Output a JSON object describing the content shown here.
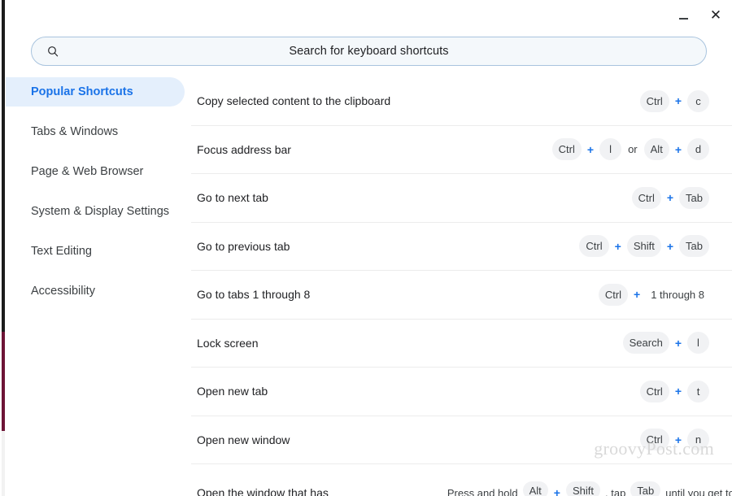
{
  "window": {
    "minimize_label": "Minimize",
    "close_label": "Close"
  },
  "search": {
    "icon": "search-icon",
    "placeholder": "Search for keyboard shortcuts",
    "value": ""
  },
  "sidebar": {
    "items": [
      {
        "label": "Popular Shortcuts",
        "active": true
      },
      {
        "label": "Tabs & Windows",
        "active": false
      },
      {
        "label": "Page & Web Browser",
        "active": false
      },
      {
        "label": "System & Display Settings",
        "active": false
      },
      {
        "label": "Text Editing",
        "active": false
      },
      {
        "label": "Accessibility",
        "active": false
      }
    ]
  },
  "shortcuts": {
    "rows": [
      {
        "label": "Copy selected content to the clipboard",
        "keys": [
          {
            "type": "chip",
            "text": "Ctrl"
          },
          {
            "type": "plus",
            "text": "+"
          },
          {
            "type": "chip",
            "text": "c"
          }
        ]
      },
      {
        "label": "Focus address bar",
        "keys": [
          {
            "type": "chip",
            "text": "Ctrl"
          },
          {
            "type": "plus",
            "text": "+"
          },
          {
            "type": "chip",
            "text": "l"
          },
          {
            "type": "or",
            "text": "or"
          },
          {
            "type": "chip",
            "text": "Alt"
          },
          {
            "type": "plus",
            "text": "+"
          },
          {
            "type": "chip",
            "text": "d"
          }
        ]
      },
      {
        "label": "Go to next tab",
        "keys": [
          {
            "type": "chip",
            "text": "Ctrl"
          },
          {
            "type": "plus",
            "text": "+"
          },
          {
            "type": "chip",
            "text": "Tab"
          }
        ]
      },
      {
        "label": "Go to previous tab",
        "keys": [
          {
            "type": "chip",
            "text": "Ctrl"
          },
          {
            "type": "plus",
            "text": "+"
          },
          {
            "type": "chip",
            "text": "Shift"
          },
          {
            "type": "plus",
            "text": "+"
          },
          {
            "type": "chip",
            "text": "Tab"
          }
        ]
      },
      {
        "label": "Go to tabs 1 through 8",
        "keys": [
          {
            "type": "chip",
            "text": "Ctrl"
          },
          {
            "type": "plus",
            "text": "+"
          },
          {
            "type": "text",
            "text": "1 through 8"
          }
        ]
      },
      {
        "label": "Lock screen",
        "keys": [
          {
            "type": "chip",
            "text": "Search"
          },
          {
            "type": "plus",
            "text": "+"
          },
          {
            "type": "chip",
            "text": "l"
          }
        ]
      },
      {
        "label": "Open new tab",
        "keys": [
          {
            "type": "chip",
            "text": "Ctrl"
          },
          {
            "type": "plus",
            "text": "+"
          },
          {
            "type": "chip",
            "text": "t"
          }
        ]
      },
      {
        "label": "Open new window",
        "keys": [
          {
            "type": "chip",
            "text": "Ctrl"
          },
          {
            "type": "plus",
            "text": "+"
          },
          {
            "type": "chip",
            "text": "n"
          }
        ]
      },
      {
        "label": "Open the window that has",
        "partial": true,
        "keys": [
          {
            "type": "text",
            "text": "Press and hold"
          },
          {
            "type": "chip",
            "text": "Alt"
          },
          {
            "type": "plus",
            "text": "+"
          },
          {
            "type": "chip",
            "text": "Shift"
          },
          {
            "type": "text",
            "text": ", tap"
          },
          {
            "type": "chip",
            "text": "Tab"
          },
          {
            "type": "text",
            "text": "until you get to the"
          }
        ]
      }
    ]
  },
  "watermark": {
    "text": "groovyPost.com"
  },
  "colors": {
    "accent_blue": "#1a73e8",
    "active_pill_bg": "#e4effc",
    "chip_bg": "#f1f2f4",
    "text_primary": "#202124",
    "text_secondary": "#3c4043",
    "divider": "#ececec",
    "search_border": "#a9c4de",
    "search_bg": "#f4f8fb"
  }
}
